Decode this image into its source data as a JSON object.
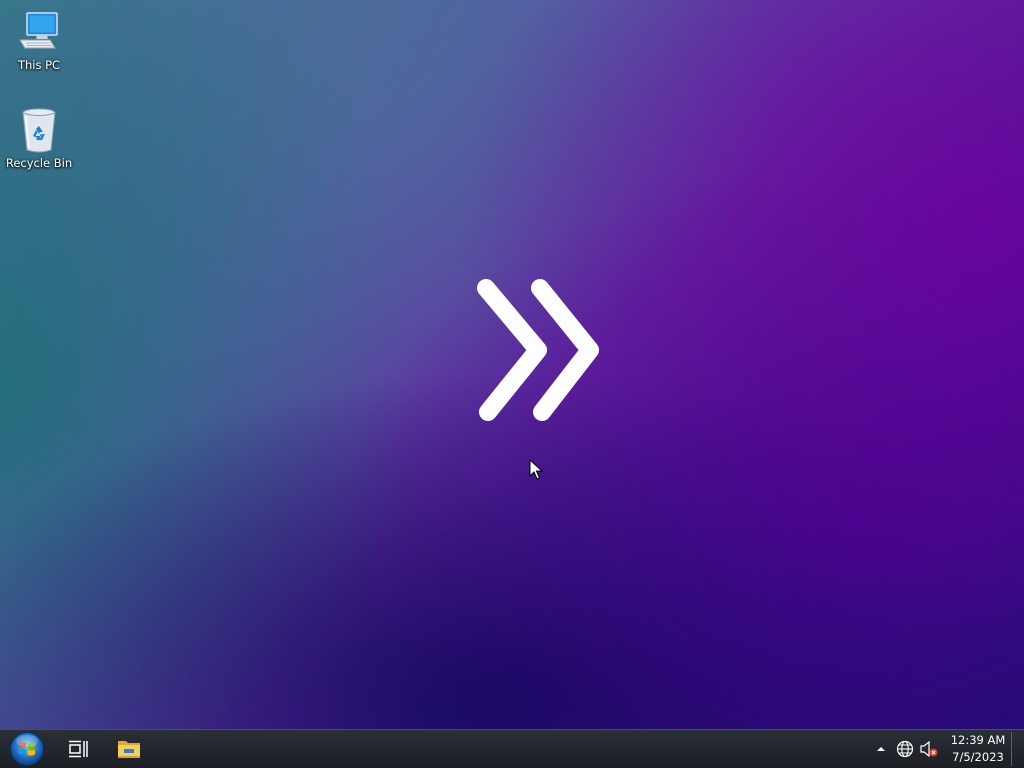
{
  "desktop": {
    "icons": [
      {
        "label": "This PC",
        "icon": "this-pc-icon"
      },
      {
        "label": "Recycle Bin",
        "icon": "recycle-bin-icon"
      }
    ],
    "center_logo": "double-chevron-right-logo"
  },
  "taskbar": {
    "start_icon": "windows-orb-icon",
    "task_view_icon": "task-view-icon",
    "file_explorer_icon": "folder-icon",
    "tray": {
      "show_hidden_icon": "chevron-up-icon",
      "network_icon": "globe-icon",
      "volume_icon": "speaker-muted-icon"
    },
    "clock": {
      "time": "12:39 AM",
      "date": "7/5/2023"
    }
  },
  "colors": {
    "taskbar_bg": "#202328",
    "text": "#ffffff",
    "folder_yellow": "#f2c94c",
    "explorer_blue": "#2f7fd0",
    "mute_red": "#e0342b"
  }
}
